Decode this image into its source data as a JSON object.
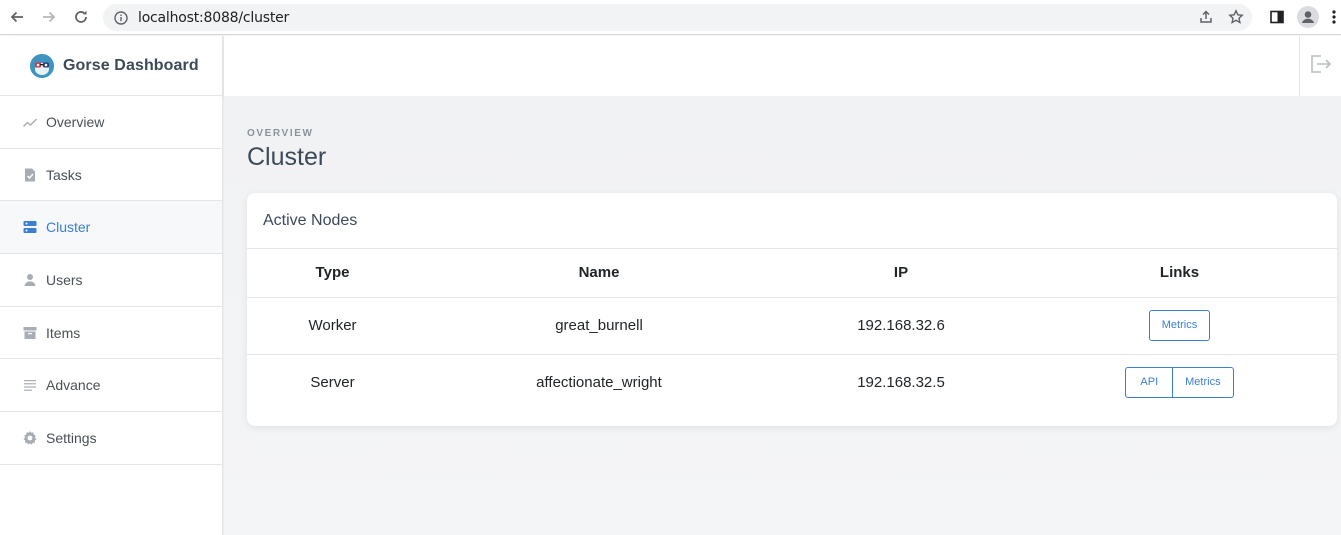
{
  "browser": {
    "url": "localhost:8088/cluster"
  },
  "brand": {
    "title": "Gorse Dashboard"
  },
  "sidebar": {
    "items": [
      {
        "label": "Overview",
        "icon": "trend-line-icon"
      },
      {
        "label": "Tasks",
        "icon": "document-check-icon"
      },
      {
        "label": "Cluster",
        "icon": "server-icon",
        "active": true
      },
      {
        "label": "Users",
        "icon": "user-icon"
      },
      {
        "label": "Items",
        "icon": "archive-box-icon"
      },
      {
        "label": "Advance",
        "icon": "list-lines-icon"
      },
      {
        "label": "Settings",
        "icon": "gear-icon"
      }
    ]
  },
  "page": {
    "eyebrow": "OVERVIEW",
    "title": "Cluster"
  },
  "card": {
    "title": "Active Nodes",
    "columns": [
      "Type",
      "Name",
      "IP",
      "Links"
    ],
    "rows": [
      {
        "type": "Worker",
        "name": "great_burnell",
        "ip": "192.168.32.6",
        "links": [
          "Metrics"
        ]
      },
      {
        "type": "Server",
        "name": "affectionate_wright",
        "ip": "192.168.32.5",
        "links": [
          "API",
          "Metrics"
        ]
      }
    ]
  },
  "colors": {
    "accent": "#3b7fd4",
    "text": "#3d4a5a"
  }
}
